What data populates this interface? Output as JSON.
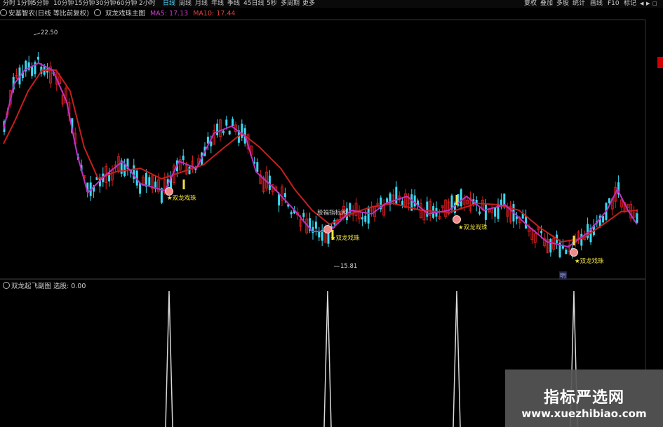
{
  "toolbar": {
    "periods": [
      {
        "label": "分时",
        "active": false
      },
      {
        "label": "1分钟",
        "active": false
      },
      {
        "label": "5分钟",
        "active": false
      },
      {
        "label": "10分钟",
        "active": false
      },
      {
        "label": "15分钟",
        "active": false
      },
      {
        "label": "30分钟",
        "active": false
      },
      {
        "label": "60分钟",
        "active": false
      },
      {
        "label": "2小时",
        "active": false
      },
      {
        "label": "日线",
        "active": true
      },
      {
        "label": "周线",
        "active": false
      },
      {
        "label": "月线",
        "active": false
      },
      {
        "label": "年线",
        "active": false
      },
      {
        "label": "季线",
        "active": false
      },
      {
        "label": "45日线",
        "active": false
      },
      {
        "label": "5秒",
        "active": false
      },
      {
        "label": "多周期",
        "active": false
      },
      {
        "label": "更多",
        "active": false
      }
    ],
    "right_items": [
      "复权",
      "叠加",
      "多股",
      "统计",
      "画线",
      "F10",
      "标记"
    ]
  },
  "title": {
    "stock": "安基智农(日线 等比前复权)",
    "indicator": "双龙戏珠主图",
    "ma5": "MA5: 17.13",
    "ma10": "MA10: 17.44"
  },
  "annotations": {
    "high": "22.50",
    "low": "15.81",
    "signal_label": "双龙戏珠",
    "source_label": "股福指标网",
    "bottom_tag": "明"
  },
  "subchart": {
    "title": "双龙起飞副图 选股: 0.00"
  },
  "watermark": {
    "title": "指标严选网",
    "url": "www.xuezhibiao.com"
  },
  "colors": {
    "up": "#e02020",
    "down": "#38d8f0",
    "ma5": "#c030c0",
    "ma10": "#c81e1e",
    "signal": "#f0e040",
    "spike": "#d8d8d8"
  }
}
